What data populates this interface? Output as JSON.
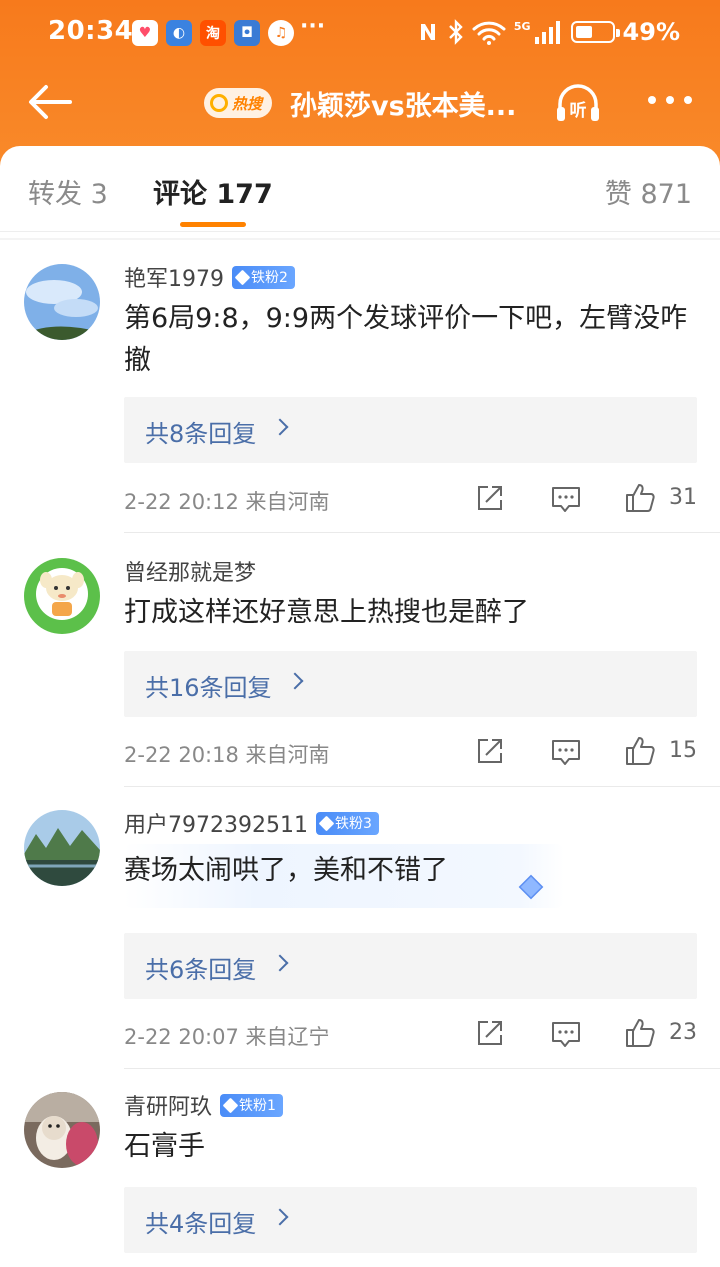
{
  "status_bar": {
    "time": "20:34",
    "app_icons": [
      "heart-app",
      "browser-app",
      "taobao-app",
      "security-app",
      "music-app"
    ],
    "app_icon_glyphs": [
      "♥",
      "◐",
      "淘",
      "◘",
      "♫"
    ],
    "overflow": "···",
    "network_label": "5G",
    "battery_percent": 49,
    "battery_text": "49%"
  },
  "nav": {
    "hot_search_tag": "热搜",
    "title": "孙颖莎vs张本美...",
    "listen_label": "听"
  },
  "tabs": {
    "repost": "转发 3",
    "comment": "评论 177",
    "like": "赞 871"
  },
  "comments": [
    {
      "username": "艳军1979",
      "fan_badge": "铁粉2",
      "text": "第6局9:8，9:9两个发球评价一下吧，左臂没咋撤",
      "replies": "共8条回复",
      "time_location": "2-22 20:12  来自河南",
      "likes": "31"
    },
    {
      "username": "曾经那就是梦",
      "fan_badge": "",
      "text": "打成这样还好意思上热搜也是醉了",
      "replies": "共16条回复",
      "time_location": "2-22 20:18  来自河南",
      "likes": "15"
    },
    {
      "username": "用户7972392511",
      "fan_badge": "铁粉3",
      "text": "赛场太闹哄了，美和不错了",
      "replies": "共6条回复",
      "time_location": "2-22 20:07  来自辽宁",
      "likes": "23"
    },
    {
      "username": "青研阿玖",
      "fan_badge": "铁粉1",
      "text": "石膏手",
      "replies": "共4条回复",
      "time_location": "",
      "likes": ""
    }
  ],
  "colors": {
    "header_orange": "#f77a1c",
    "accent": "#ff8200",
    "link_blue": "#4a6ea8",
    "badge_blue": "#4a8cf7"
  }
}
